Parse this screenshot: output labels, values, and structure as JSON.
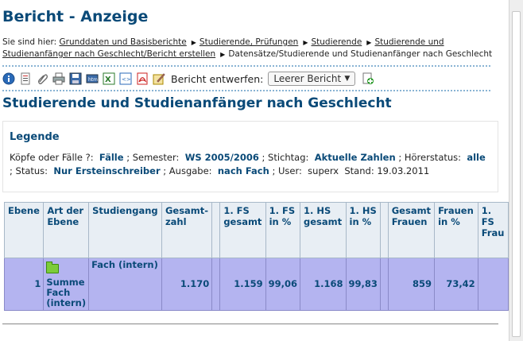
{
  "page": {
    "title": "Bericht - Anzeige",
    "subtitle": "Studierende und Studienanfänger nach Geschlecht"
  },
  "breadcrumb": {
    "prefix": "Sie sind hier:",
    "items": [
      "Grunddaten und Basisberichte",
      "Studierende, Prüfungen",
      "Studierende",
      "Studierende und Studienanfänger nach Geschlecht/Bericht erstellen",
      "Datensätze/Studierende und Studienanfänger nach Geschlecht"
    ]
  },
  "toolbar": {
    "icons": [
      "info-icon",
      "report-icon",
      "attachment-icon",
      "print-icon",
      "save-icon",
      "table-icon",
      "excel-icon",
      "xml-icon",
      "pdf-icon",
      "edit-icon"
    ],
    "design_label": "Bericht entwerfen:",
    "design_select_value": "Leerer Bericht",
    "new_icon": "new-report-icon"
  },
  "legend": {
    "heading": "Legende",
    "k_koepfe": "Köpfe oder Fälle ?:",
    "v_koepfe": "Fälle",
    "k_semester": "; Semester:",
    "v_semester": "WS 2005/2006",
    "k_stichtag": "; Stichtag:",
    "v_stichtag": "Aktuelle Zahlen",
    "k_hoerer": "; Hörerstatus:",
    "v_hoerer": "alle",
    "k_status": "; Status:",
    "v_status": "Nur Ersteinschreiber",
    "k_ausgabe": "; Ausgabe:",
    "v_ausgabe": "nach Fach",
    "k_user": "; User:",
    "v_user": "superx",
    "k_stand": "Stand:",
    "v_stand": "19.03.2011"
  },
  "table": {
    "headers": [
      "Ebene",
      "Art der Ebene",
      "Studiengang",
      "Gesamt-zahl",
      "",
      "1. FS gesamt",
      "1. FS in %",
      "1. HS gesamt",
      "1. HS in %",
      "",
      "Gesamt Frauen",
      "Frauen in %",
      "1. FS Frau"
    ],
    "rows": [
      {
        "ebene": "1",
        "art": "Summe Fach (intern)",
        "studiengang": "Fach (intern)",
        "gesamtzahl": "1.170",
        "gap1": "",
        "fs_gesamt": "1.159",
        "fs_pct": "99,06",
        "hs_gesamt": "1.168",
        "hs_pct": "99,83",
        "gap2": "",
        "frauen_gesamt": "859",
        "frauen_pct": "73,42",
        "fs_frauen": ""
      }
    ]
  }
}
